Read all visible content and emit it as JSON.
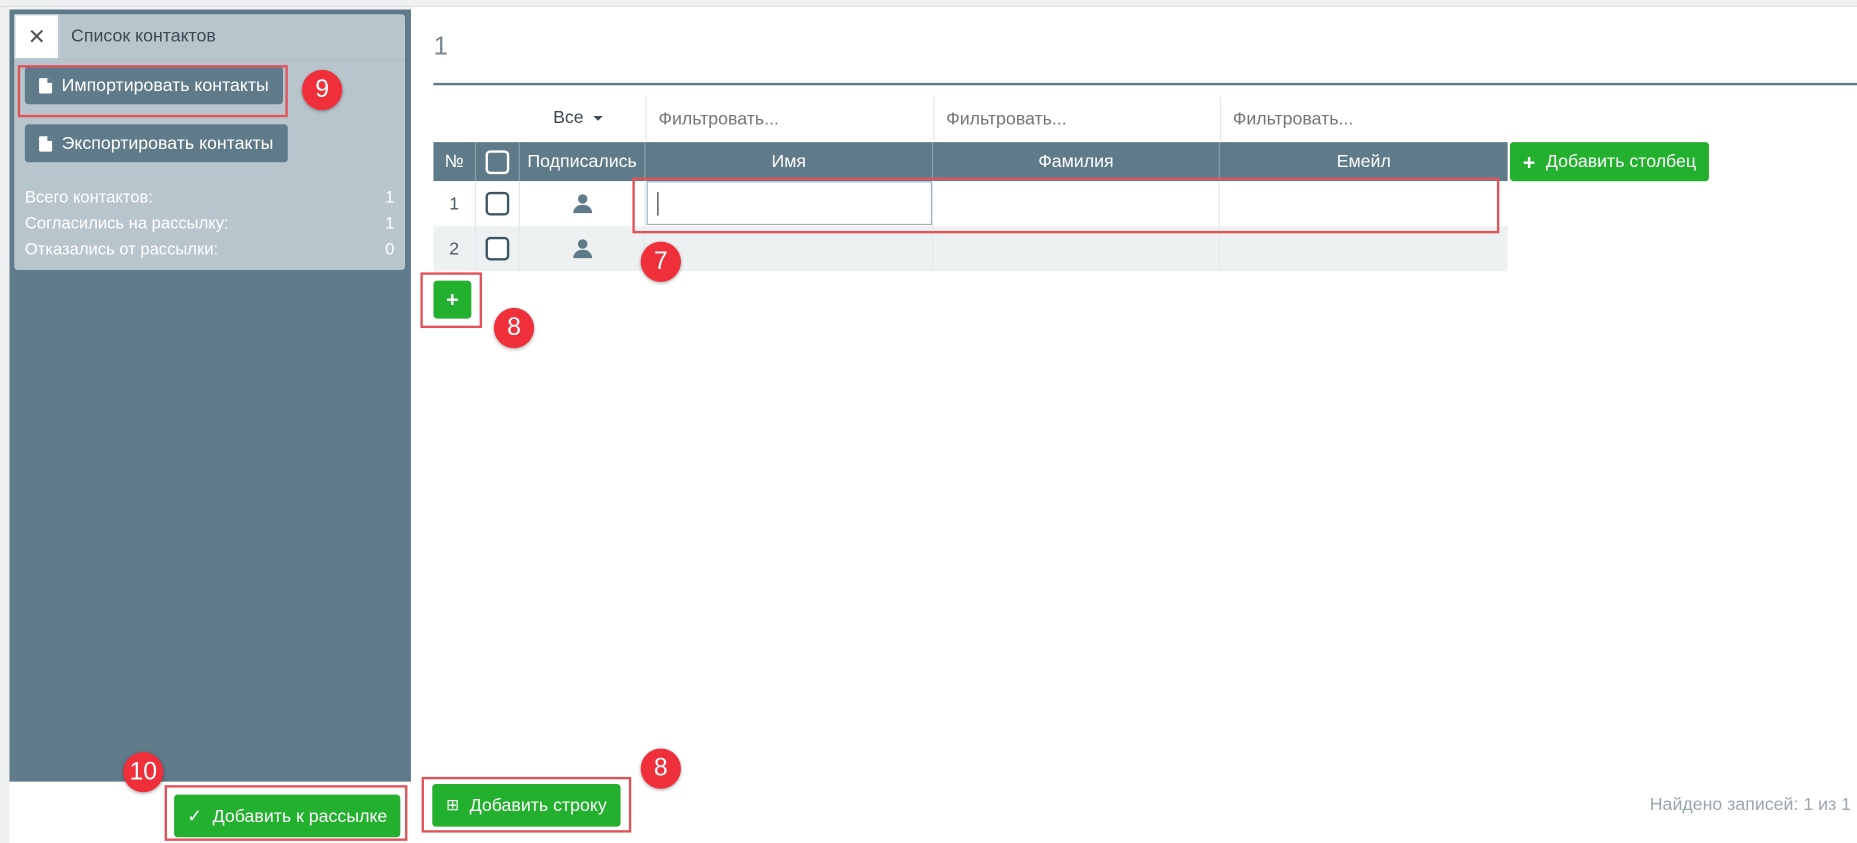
{
  "sidebar": {
    "title": "Список контактов",
    "close_icon": "close-icon",
    "import_label": "Импортировать контакты",
    "export_label": "Экспортировать контакты",
    "stats": [
      {
        "label": "Всего контактов:",
        "value": "1"
      },
      {
        "label": "Согласились на рассылку:",
        "value": "1"
      },
      {
        "label": "Отказались от рассылки:",
        "value": "0"
      }
    ],
    "add_to_mailing_label": "Добавить к рассылке"
  },
  "main": {
    "page_number": "1",
    "filters": {
      "subscribed_select": "Все",
      "first_name_placeholder": "Фильтровать...",
      "last_name_placeholder": "Фильтровать...",
      "email_placeholder": "Фильтровать..."
    },
    "columns": [
      "№",
      "",
      "Подписались",
      "Имя",
      "Фамилия",
      "Емейл"
    ],
    "add_column_label": "Добавить столбец",
    "rows": [
      {
        "num": "1",
        "first_name": "",
        "last_name": "",
        "email": ""
      },
      {
        "num": "2",
        "first_name": "",
        "last_name": "",
        "email": ""
      }
    ],
    "add_row_label": "Добавить строку",
    "found_text": "Найдено записей: 1 из 1"
  },
  "annotations": [
    "7",
    "8",
    "8",
    "9",
    "10"
  ],
  "colors": {
    "sidebar": "#5f7a88",
    "panel": "#b9c5cc",
    "accent_green": "#22b02e",
    "annotation_red": "#ef2f3a"
  }
}
